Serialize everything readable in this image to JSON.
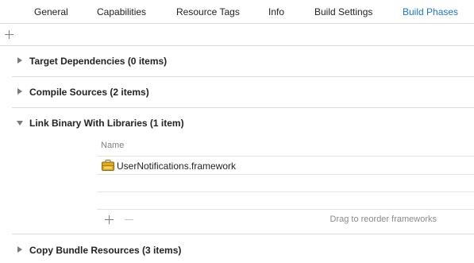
{
  "tabs": [
    {
      "label": "General",
      "active": false
    },
    {
      "label": "Capabilities",
      "active": false
    },
    {
      "label": "Resource Tags",
      "active": false
    },
    {
      "label": "Info",
      "active": false
    },
    {
      "label": "Build Settings",
      "active": false
    },
    {
      "label": "Build Phases",
      "active": true
    }
  ],
  "toolbar": {
    "add_icon": "plus-icon"
  },
  "phases": [
    {
      "title": "Target Dependencies (0 items)",
      "expanded": false
    },
    {
      "title": "Compile Sources (2 items)",
      "expanded": false
    },
    {
      "title": "Link Binary With Libraries (1 item)",
      "expanded": true
    },
    {
      "title": "Copy Bundle Resources (3 items)",
      "expanded": false
    }
  ],
  "libraries": {
    "column_header": "Name",
    "items": [
      {
        "name": "UserNotifications.framework",
        "icon": "framework-icon"
      }
    ],
    "add_icon": "plus-icon",
    "remove_icon": "minus-icon",
    "hint": "Drag to reorder frameworks"
  },
  "colors": {
    "accent": "#1a73d9",
    "separator": "#dcdcdc",
    "framework_icon": "#e0a81c"
  }
}
